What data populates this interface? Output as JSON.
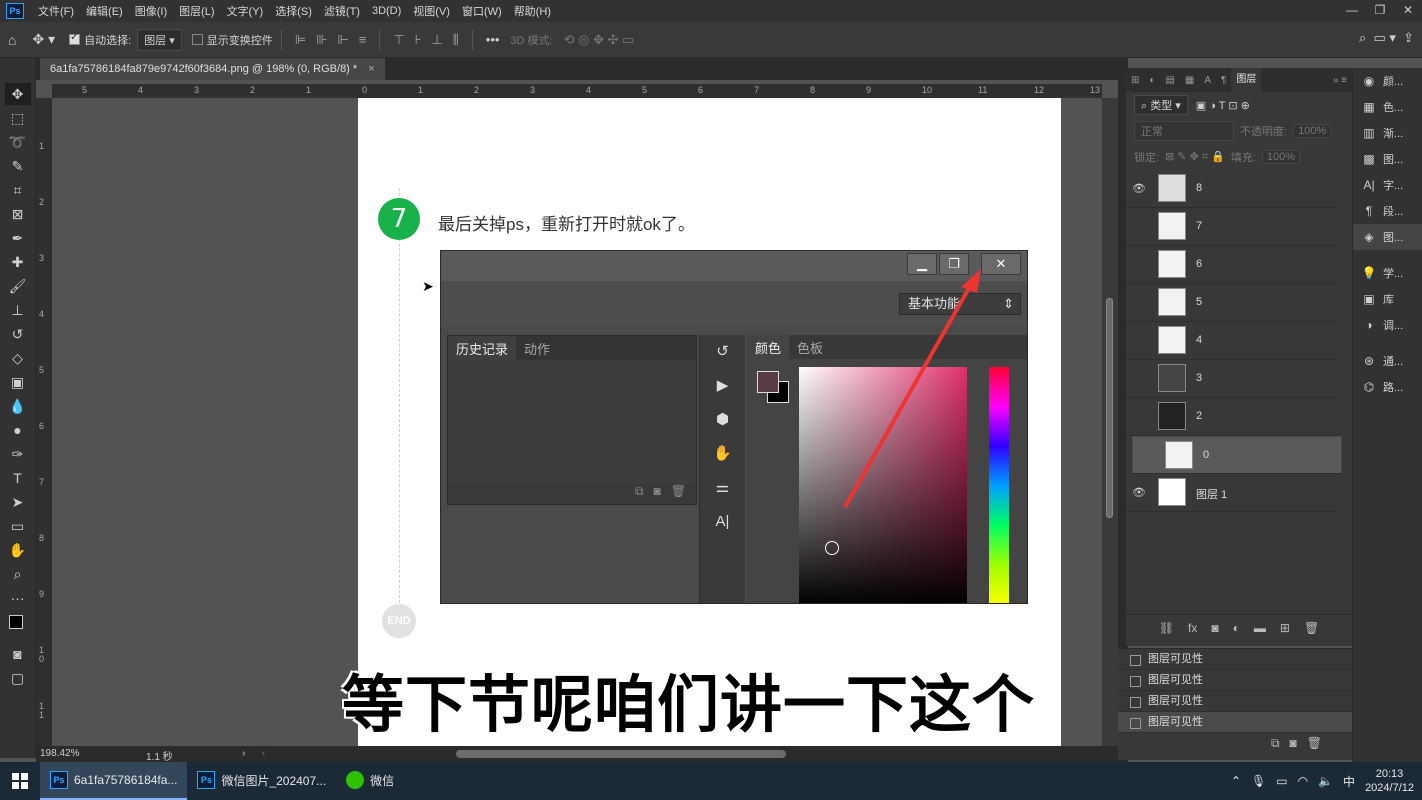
{
  "menu": {
    "app_logo": "Ps",
    "items": [
      "文件(F)",
      "编辑(E)",
      "图像(I)",
      "图层(L)",
      "文字(Y)",
      "选择(S)",
      "滤镜(T)",
      "3D(D)",
      "视图(V)",
      "窗口(W)",
      "帮助(H)"
    ]
  },
  "options": {
    "auto_select_label": "自动选择:",
    "auto_select_value": "图层",
    "show_transform_label": "显示变换控件",
    "mode_3d_label": "3D 模式:"
  },
  "document": {
    "tab_title": "6a1fa75786184fa879e9742f60f3684.png @ 198% (0, RGB/8) *",
    "tab_close": "×",
    "zoom": "198.42%",
    "timing": "1.1 秒",
    "ruler_h": [
      "5",
      "4",
      "3",
      "2",
      "1",
      "0",
      "1",
      "2",
      "3",
      "4",
      "5",
      "6",
      "7",
      "8",
      "9",
      "10",
      "11",
      "12",
      "13"
    ],
    "ruler_v": [
      "1",
      "2",
      "3",
      "4",
      "5",
      "6",
      "7",
      "8",
      "9",
      "1 0",
      "1 1"
    ]
  },
  "content": {
    "step_number": "7",
    "step_text": "最后关掉ps，重新打开时就ok了。",
    "end_label": "END",
    "subtitle": "等下节呢咱们讲一下这个",
    "screenshot": {
      "workspace": "基本功能",
      "history_tab": "历史记录",
      "actions_tab": "动作",
      "color_tab": "颜色",
      "swatches_tab": "色板"
    }
  },
  "layers": {
    "tabs": [
      "图层"
    ],
    "filter_label": "类型",
    "blend_mode": "正常",
    "opacity_label": "不透明度:",
    "opacity_value": "100%",
    "lock_label": "锁定:",
    "fill_label": "填充:",
    "fill_value": "100%",
    "items": [
      {
        "name": "8",
        "visible": true
      },
      {
        "name": "7",
        "visible": false
      },
      {
        "name": "6",
        "visible": false
      },
      {
        "name": "5",
        "visible": false
      },
      {
        "name": "4",
        "visible": false
      },
      {
        "name": "3",
        "visible": false
      },
      {
        "name": "2",
        "visible": false
      },
      {
        "name": "0",
        "visible": false,
        "selected": true
      },
      {
        "name": "图层 1",
        "visible": true
      }
    ],
    "footer_fx": "fx"
  },
  "history_visibility": [
    "图层可见性",
    "图层可见性",
    "图层可见性",
    "图层可见性"
  ],
  "right_panels": [
    "颜...",
    "色...",
    "渐...",
    "图...",
    "字...",
    "段...",
    "图...",
    "学...",
    "库",
    "调...",
    "通...",
    "路..."
  ],
  "taskbar": {
    "items": [
      {
        "label": "6a1fa75786184fa...",
        "icon": "ps-icon",
        "active": true
      },
      {
        "label": "微信图片_202407...",
        "icon": "ps-icon",
        "active": false
      },
      {
        "label": "微信",
        "icon": "wechat-icon",
        "active": false
      }
    ],
    "ime": "中",
    "time": "20:13",
    "date": "2024/7/12"
  }
}
